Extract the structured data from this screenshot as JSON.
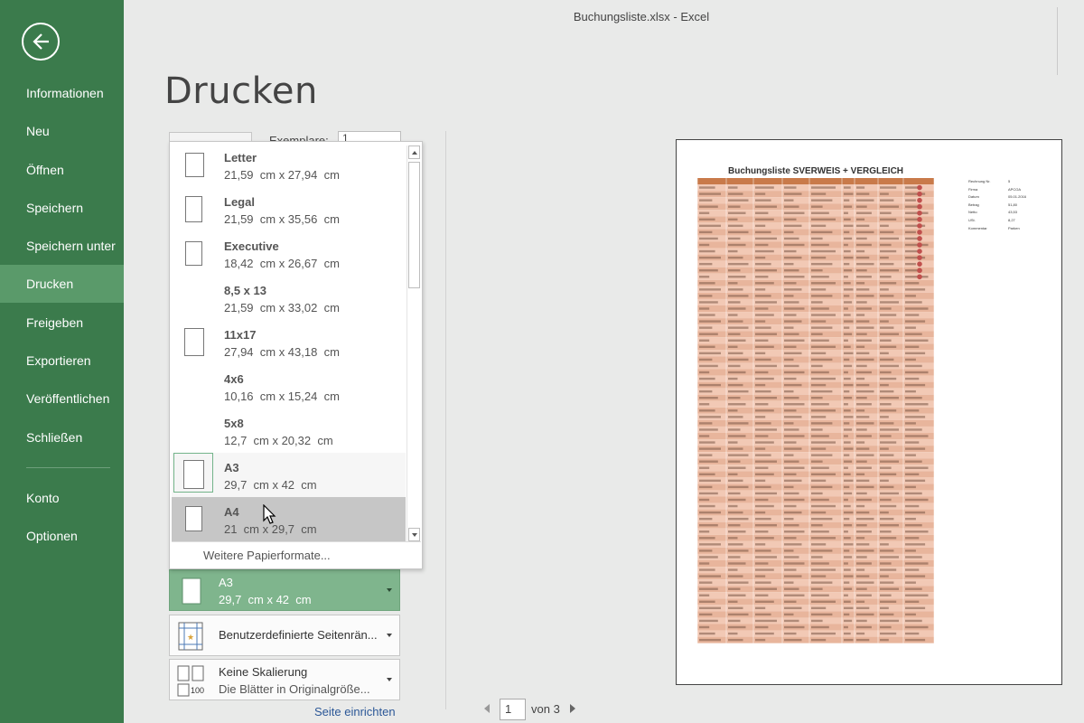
{
  "window": {
    "title": "Buchungsliste.xlsx - Excel"
  },
  "sidebar": {
    "items": [
      {
        "label": "Informationen"
      },
      {
        "label": "Neu"
      },
      {
        "label": "Öffnen"
      },
      {
        "label": "Speichern"
      },
      {
        "label": "Speichern unter"
      },
      {
        "label": "Drucken",
        "active": true
      },
      {
        "label": "Freigeben"
      },
      {
        "label": "Exportieren"
      },
      {
        "label": "Veröffentlichen"
      },
      {
        "label": "Schließen"
      },
      {
        "label": "Konto"
      },
      {
        "label": "Optionen"
      }
    ]
  },
  "page": {
    "title": "Drucken"
  },
  "copies": {
    "label": "Exemplare:",
    "value": "1"
  },
  "paper_dropdown": {
    "items": [
      {
        "name": "Letter",
        "size": "21,59  cm x 27,94  cm"
      },
      {
        "name": "Legal",
        "size": "21,59  cm x 35,56  cm"
      },
      {
        "name": "Executive",
        "size": "18,42  cm x 26,67  cm"
      },
      {
        "name": "8,5 x 13",
        "size": "21,59  cm x 33,02  cm"
      },
      {
        "name": "11x17",
        "size": "27,94  cm x 43,18  cm"
      },
      {
        "name": "4x6",
        "size": "10,16  cm x 15,24  cm"
      },
      {
        "name": "5x8",
        "size": "12,7  cm x 20,32  cm"
      },
      {
        "name": "A3",
        "size": "29,7  cm x 42  cm",
        "selected": true
      },
      {
        "name": "A4",
        "size": "21  cm x 29,7  cm",
        "hover": true
      }
    ],
    "more_label": "Weitere Papierformate..."
  },
  "settings": {
    "paper": {
      "line1": "A3",
      "line2": "29,7  cm x 42  cm"
    },
    "margins": {
      "line1": "Benutzerdefinierte Seitenrän..."
    },
    "scaling": {
      "line1": "Keine Skalierung",
      "line2": "Die Blätter in Originalgröße...",
      "icon_text": "100"
    },
    "page_setup_link": "Seite einrichten"
  },
  "preview": {
    "sheet_title": "Buchungsliste SVERWEIS + VERGLEICH",
    "side_info": [
      {
        "k": "Rechnung Nr.",
        "v": "5"
      },
      {
        "k": "Firma",
        "v": "APCOA"
      },
      {
        "k": "Datum",
        "v": "05.01.2016"
      },
      {
        "k": "Betrag",
        "v": "51,80"
      },
      {
        "k": "Netto",
        "v": "43,53"
      },
      {
        "k": "USt.",
        "v": "8,27"
      },
      {
        "k": "Kommentar",
        "v": "Parken"
      }
    ]
  },
  "pager": {
    "current": "1",
    "of_label": "von 3"
  },
  "colors": {
    "sidebar": "#3b7b4c",
    "sidebar_active": "#5a9a6a",
    "selected_setting": "#7fb58d",
    "table_header": "#c97a4a",
    "table_row_a": "#f2c9b5",
    "table_row_b": "#e8b59c",
    "status_dot": "#c0504d"
  }
}
